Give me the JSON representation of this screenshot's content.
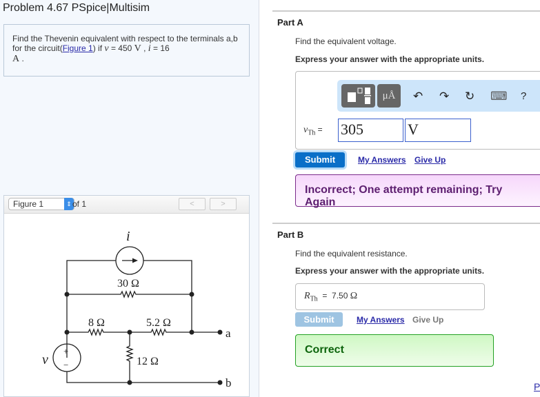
{
  "problem": {
    "title": "Problem 4.67 PSpice|Multisim",
    "text_1": "Find the Thevenin equivalent with respect to the terminals a,b for the circuit(",
    "figure_link": "Figure 1",
    "text_2": ") if ",
    "v_sym": "v",
    "eq1": " = 450 ",
    "unit_v": "V",
    "comma": " , ",
    "i_sym": "i",
    "eq2": " = 16",
    "unit_a": "A",
    "period": " ."
  },
  "figure": {
    "selected": "Figure 1",
    "of": "of 1",
    "prev": "<",
    "next": ">",
    "labels": {
      "i": "i",
      "r30": "30 Ω",
      "r8": "8 Ω",
      "r52": "5.2 Ω",
      "r12": "12 Ω",
      "v": "v",
      "plus": "+",
      "minus": "−",
      "a": "a",
      "b": "b"
    }
  },
  "partA": {
    "label": "Part A",
    "prompt": "Find the equivalent voltage.",
    "instruction": "Express your answer with the appropriate units.",
    "toolbar": {
      "units": "μÅ",
      "undo": "↶",
      "redo": "↷",
      "reset": "↻",
      "keyboard": "⌨",
      "help": "?"
    },
    "var_main": "v",
    "var_sub": "Th",
    "equals": "=",
    "value": "305",
    "unit": "V",
    "submit": "Submit",
    "my_answers": "My Answers",
    "give_up": "Give Up",
    "feedback": "Incorrect; One attempt remaining; Try Again"
  },
  "partB": {
    "label": "Part B",
    "prompt": "Find the equivalent resistance.",
    "instruction": "Express your answer with the appropriate units.",
    "var_main": "R",
    "var_sub": "Th",
    "equals": "=",
    "answer": "7.50",
    "unit": "Ω",
    "submit": "Submit",
    "my_answers": "My Answers",
    "give_up": "Give Up",
    "feedback": "Correct"
  },
  "footer_link": "P"
}
